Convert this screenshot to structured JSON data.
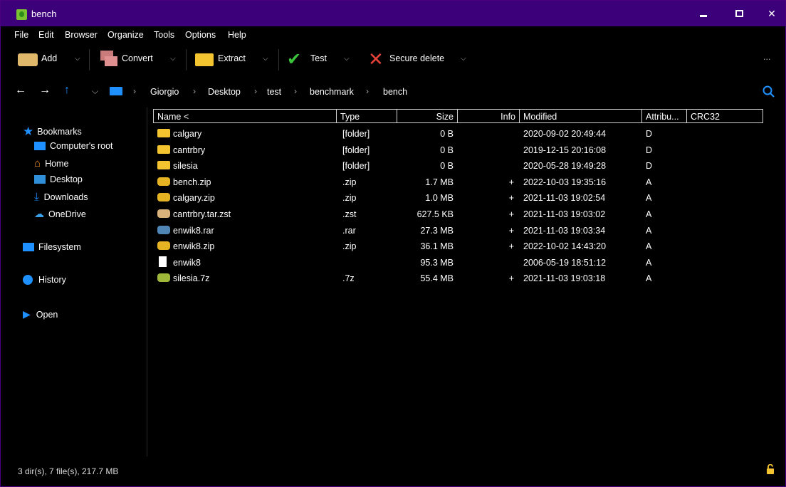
{
  "window": {
    "title": "bench"
  },
  "menu": [
    "File",
    "Edit",
    "Browser",
    "Organize",
    "Tools",
    "Options",
    "Help"
  ],
  "toolbar": {
    "add": "Add",
    "convert": "Convert",
    "extract": "Extract",
    "test": "Test",
    "secure_delete": "Secure delete",
    "more": "..."
  },
  "breadcrumb": [
    "Giorgio",
    "Desktop",
    "test",
    "benchmark",
    "bench"
  ],
  "sidebar": {
    "bookmarks": "Bookmarks",
    "computer_root": "Computer's root",
    "home": "Home",
    "desktop": "Desktop",
    "downloads": "Downloads",
    "onedrive": "OneDrive",
    "filesystem": "Filesystem",
    "history": "History",
    "open": "Open"
  },
  "columns": {
    "name": "Name <",
    "type": "Type",
    "size": "Size",
    "info": "Info",
    "modified": "Modified",
    "attributes": "Attribu...",
    "crc32": "CRC32"
  },
  "files": [
    {
      "name": "calgary",
      "type": "[folder]",
      "size": "0 B",
      "info": "",
      "modified": "2020-09-02 20:49:44",
      "attr": "D",
      "icon": "folder",
      "color": "#f4c430"
    },
    {
      "name": "cantrbry",
      "type": "[folder]",
      "size": "0 B",
      "info": "",
      "modified": "2019-12-15 20:16:08",
      "attr": "D",
      "icon": "folder",
      "color": "#f4c430"
    },
    {
      "name": "silesia",
      "type": "[folder]",
      "size": "0 B",
      "info": "",
      "modified": "2020-05-28 19:49:28",
      "attr": "D",
      "icon": "folder",
      "color": "#f4c430"
    },
    {
      "name": "bench.zip",
      "type": ".zip",
      "size": "1.7 MB",
      "info": "+",
      "modified": "2022-10-03 19:35:16",
      "attr": "A",
      "icon": "archive",
      "color": "#e6b422"
    },
    {
      "name": "calgary.zip",
      "type": ".zip",
      "size": "1.0 MB",
      "info": "+",
      "modified": "2021-11-03 19:02:54",
      "attr": "A",
      "icon": "archive",
      "color": "#e6b422"
    },
    {
      "name": "cantrbry.tar.zst",
      "type": ".zst",
      "size": "627.5 KB",
      "info": "+",
      "modified": "2021-11-03 19:03:02",
      "attr": "A",
      "icon": "archive",
      "color": "#d8b27a"
    },
    {
      "name": "enwik8.rar",
      "type": ".rar",
      "size": "27.3 MB",
      "info": "+",
      "modified": "2021-11-03 19:03:34",
      "attr": "A",
      "icon": "archive",
      "color": "#4f86b5"
    },
    {
      "name": "enwik8.zip",
      "type": ".zip",
      "size": "36.1 MB",
      "info": "+",
      "modified": "2022-10-02 14:43:20",
      "attr": "A",
      "icon": "archive",
      "color": "#e6b422"
    },
    {
      "name": "enwik8",
      "type": "",
      "size": "95.3 MB",
      "info": "",
      "modified": "2006-05-19 18:51:12",
      "attr": "A",
      "icon": "file",
      "color": "#ffffff"
    },
    {
      "name": "silesia.7z",
      "type": ".7z",
      "size": "55.4 MB",
      "info": "+",
      "modified": "2021-11-03 19:03:18",
      "attr": "A",
      "icon": "archive",
      "color": "#9fb83a"
    }
  ],
  "status": "3 dir(s), 7 file(s), 217.7 MB",
  "colors": {
    "titlebar": "#3c007a",
    "accent": "#1e90ff"
  }
}
